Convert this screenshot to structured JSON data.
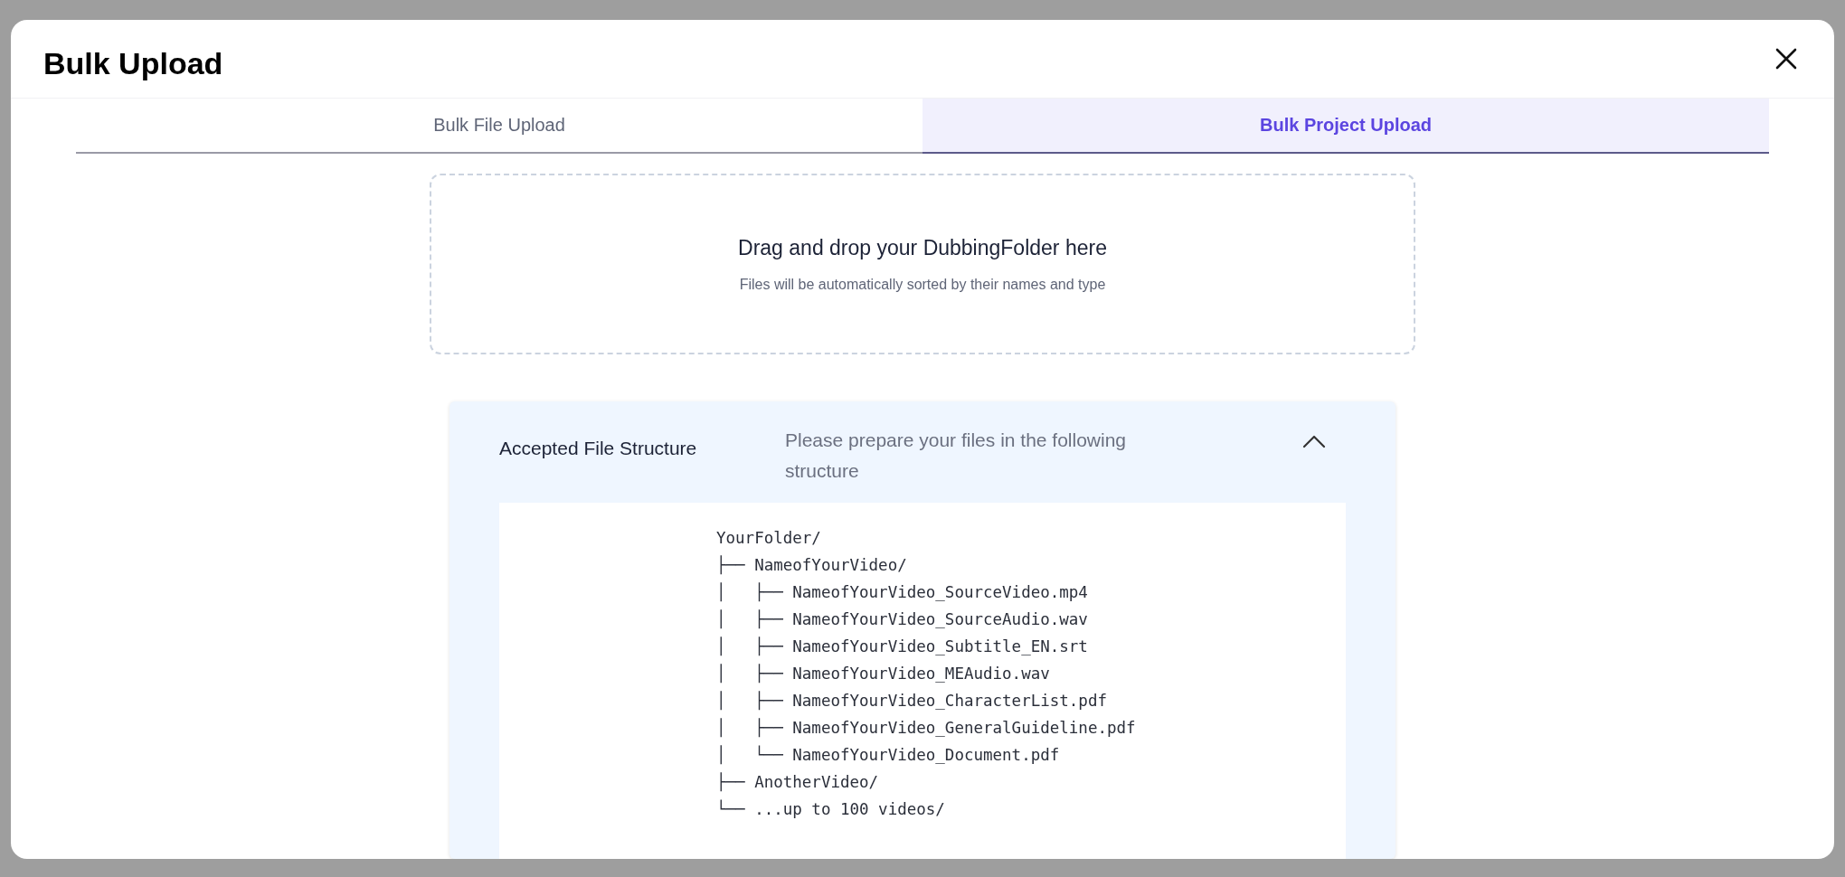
{
  "dialog": {
    "title": "Bulk Upload"
  },
  "tabs": [
    {
      "label": "Bulk File Upload",
      "selected": false
    },
    {
      "label": "Bulk Project Upload",
      "selected": true
    }
  ],
  "dropzone": {
    "title": "Drag and drop your DubbingFolder here",
    "hint": "Files will be automatically sorted by their names and type"
  },
  "structure": {
    "title": "Accepted File Structure",
    "description": "Please prepare your files in the following structure",
    "expanded": true,
    "tree": {
      "name": "YourFolder/",
      "children": [
        {
          "prefix": "├── ",
          "name": "NameofYourVideo/",
          "children": [
            {
              "prefix": "│   ├── ",
              "name": "NameofYourVideo_SourceVideo.mp4"
            },
            {
              "prefix": "│   ├── ",
              "name": "NameofYourVideo_SourceAudio.wav"
            },
            {
              "prefix": "│   ├── ",
              "name": "NameofYourVideo_Subtitle_EN.srt"
            },
            {
              "prefix": "│   ├── ",
              "name": "NameofYourVideo_MEAudio.wav"
            },
            {
              "prefix": "│   ├── ",
              "name": "NameofYourVideo_CharacterList.pdf"
            },
            {
              "prefix": "│   ├── ",
              "name": "NameofYourVideo_GeneralGuideline.pdf"
            },
            {
              "prefix": "│   └── ",
              "name": "NameofYourVideo_Document.pdf"
            }
          ]
        },
        {
          "prefix": "├── ",
          "name": "AnotherVideo/"
        },
        {
          "prefix": "└── ",
          "name": "...up to 100 videos/"
        }
      ]
    }
  }
}
